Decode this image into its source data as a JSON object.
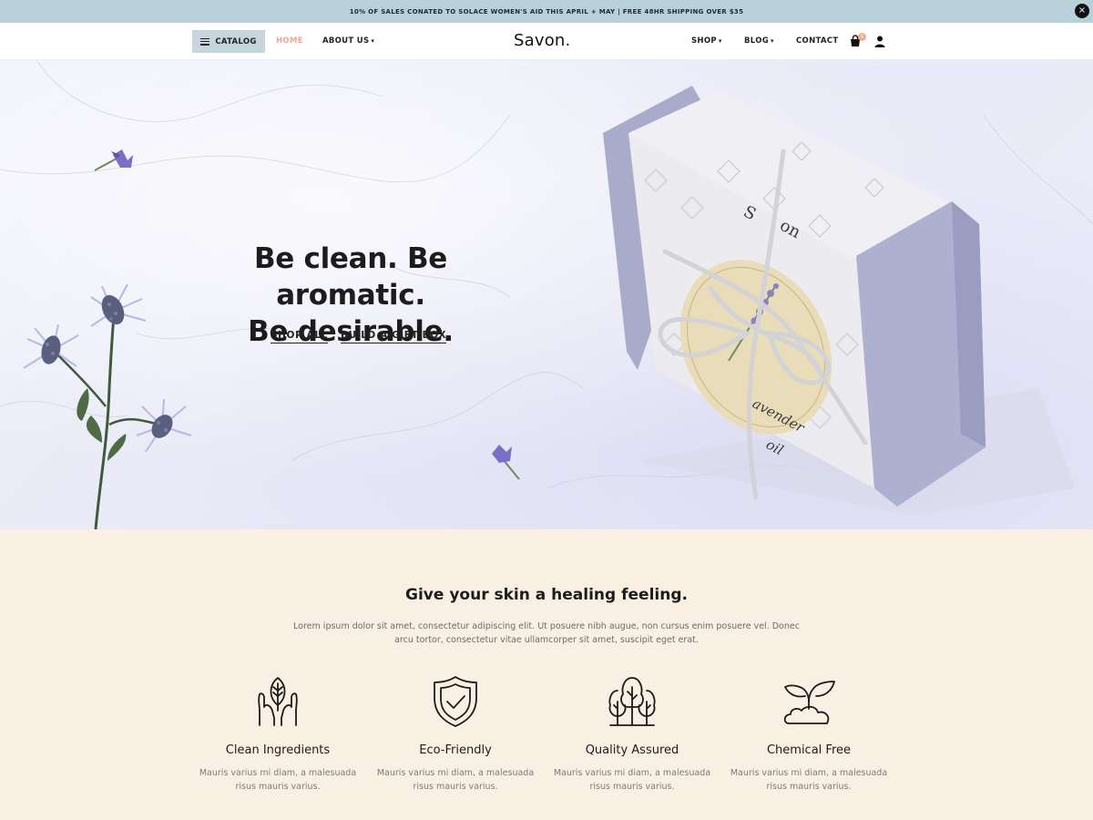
{
  "announcement": {
    "text": "10% OF SALES CONATED TO SOLACE WOMEN'S AID THIS APRIL + MAY | FREE 48HR SHIPPING OVER $35",
    "close_icon": "×"
  },
  "header": {
    "catalog_label": "CATALOG",
    "nav_left": [
      {
        "label": "HOME"
      },
      {
        "label": "ABOUT US"
      }
    ],
    "logo": "Savon.",
    "nav_right": [
      {
        "label": "SHOP"
      },
      {
        "label": "BLOG"
      },
      {
        "label": "CONTACT"
      }
    ],
    "cart_count": "0",
    "chevron": "⌄"
  },
  "hero": {
    "title_line1": "Be clean. Be aromatic.",
    "title_line2": "Be desirable.",
    "cta_shop": "SHOP ALL",
    "cta_gift": "BUILD A GIFT BOX"
  },
  "features": {
    "title": "Give your skin a healing feeling.",
    "description": "Lorem ipsum dolor sit amet, consectetur adipiscing elit. Ut posuere nibh augue, non cursus enim posuere vel. Donec arcu tortor, consectetur vitae ullamcorper sit amet, suscipit eget erat.",
    "items": [
      {
        "icon": "hands-leaf-icon",
        "title": "Clean Ingredients",
        "text": "Mauris varius mi diam, a malesuada risus mauris varius."
      },
      {
        "icon": "shield-check-icon",
        "title": "Eco-Friendly",
        "text": "Mauris varius mi diam, a malesuada risus mauris varius."
      },
      {
        "icon": "trees-icon",
        "title": "Quality Assured",
        "text": "Mauris varius mi diam, a malesuada risus mauris varius."
      },
      {
        "icon": "plant-cloud-icon",
        "title": "Chemical Free",
        "text": "Mauris varius mi diam, a malesuada risus mauris varius."
      }
    ]
  },
  "colors": {
    "announcement_bg": "#b7d0d9",
    "catalog_bg": "#c6d6dc",
    "home_active": "#e9a996",
    "cart_badge": "#f2a98e",
    "features_bg": "#faefe3",
    "soap_lavender": "#a8abc9"
  }
}
